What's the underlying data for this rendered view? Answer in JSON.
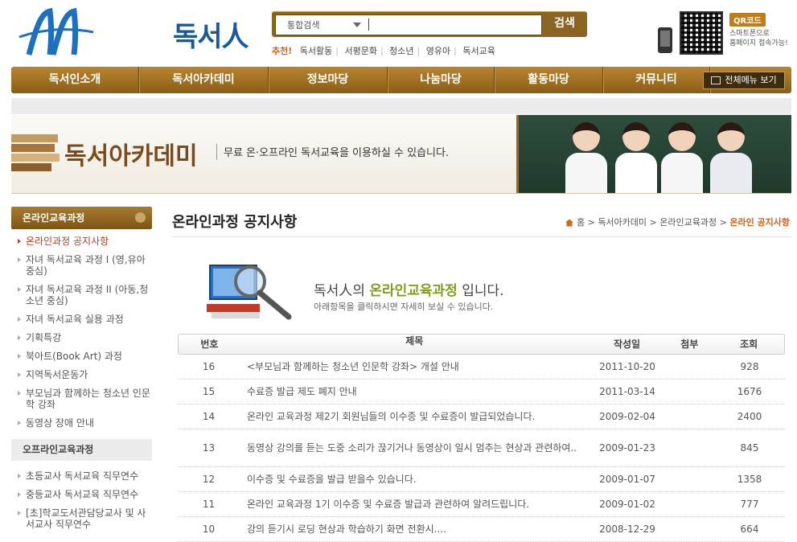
{
  "header": {
    "brand": "독서人",
    "search": {
      "category": "통합검색",
      "button": "검색",
      "query": ""
    },
    "recommend": {
      "label": "추천!",
      "links": [
        "독서활동",
        "서평문화",
        "청소년",
        "영유아",
        "독서교육"
      ]
    },
    "qr": {
      "badge": "QR코드",
      "line1": "스마트폰으로",
      "line2": "홈페이지 접속가능!"
    }
  },
  "nav": {
    "items": [
      "독서인소개",
      "독서아카데미",
      "정보마당",
      "나눔마당",
      "활동마당",
      "커뮤니티"
    ],
    "all_menu": "전체메뉴 보기"
  },
  "banner": {
    "title": "독서아카데미",
    "desc": "무료 온·오프라인 독서교육을 이용하실 수 있습니다."
  },
  "sidebar": {
    "section1": "온라인교육과정",
    "items1": [
      {
        "label": "온라인과정 공지사항",
        "active": true
      },
      {
        "label": "자녀 독서교육 과정 I (영,유아 중심)"
      },
      {
        "label": "자녀 독서교육 과정 II (아동,청소년 중심)"
      },
      {
        "label": "자녀 독서교육 실용 과정"
      },
      {
        "label": "기획특강"
      },
      {
        "label": "북아트(Book Art) 과정"
      },
      {
        "label": "지역독서운동가"
      },
      {
        "label": "부모님과 함께하는 청소년 인문학 강좌"
      },
      {
        "label": "동영상 장애 안내"
      }
    ],
    "section2": "오프라인교육과정",
    "items2": [
      {
        "label": "초등교사 독서교육 직무연수"
      },
      {
        "label": "중등교사 독서교육 직무연수"
      },
      {
        "label": "[초]학교도서관담당교사 및 사서교사 직무연수"
      }
    ]
  },
  "main": {
    "title": "온라인과정 공지사항",
    "breadcrumb": {
      "home": "홈",
      "items": [
        "독서아카데미",
        "온라인교육과정"
      ],
      "current": "온라인 공지사항"
    },
    "intro": {
      "pre": "독서人의 ",
      "highlight": "온라인교육과정",
      "post": " 입니다.",
      "sub": "아래항목을 클릭하시면 자세히 보실 수 있습니다."
    },
    "table": {
      "headers": {
        "no": "번호",
        "title": "제목",
        "date": "작성일",
        "attach": "첨부",
        "views": "조회"
      },
      "rows": [
        {
          "no": "16",
          "title": "<부모님과 함께하는 청소년 인문학 강좌> 개설 안내",
          "date": "2011-10-20",
          "attach": "",
          "views": "928"
        },
        {
          "no": "15",
          "title": "수료증 발급 제도 폐지 안내",
          "date": "2011-03-14",
          "attach": "",
          "views": "1676"
        },
        {
          "no": "14",
          "title": "온라인 교육과정 제2기 회원님들의 이수증 및 수료증이 발급되었습니다.",
          "date": "2009-02-04",
          "attach": "",
          "views": "2400"
        },
        {
          "no": "13",
          "title": "동영상 강의를 듣는 도중 소리가 끊기거나 동영상이 일시 멈추는 현상과 관련하여..",
          "date": "2009-01-23",
          "attach": "",
          "views": "845"
        },
        {
          "no": "12",
          "title": "이수증 및 수료증을 발급 받을수 있습니다.",
          "date": "2009-01-07",
          "attach": "",
          "views": "1358"
        },
        {
          "no": "11",
          "title": "온라인 교육과정 1기 이수증 및 수료증 발급과 관련하여 알려드립니다.",
          "date": "2009-01-02",
          "attach": "",
          "views": "777"
        },
        {
          "no": "10",
          "title": "강의 듣기시 로딩 현상과 학습하기 화면 전환시....",
          "date": "2008-12-29",
          "attach": "",
          "views": "664"
        }
      ]
    }
  }
}
